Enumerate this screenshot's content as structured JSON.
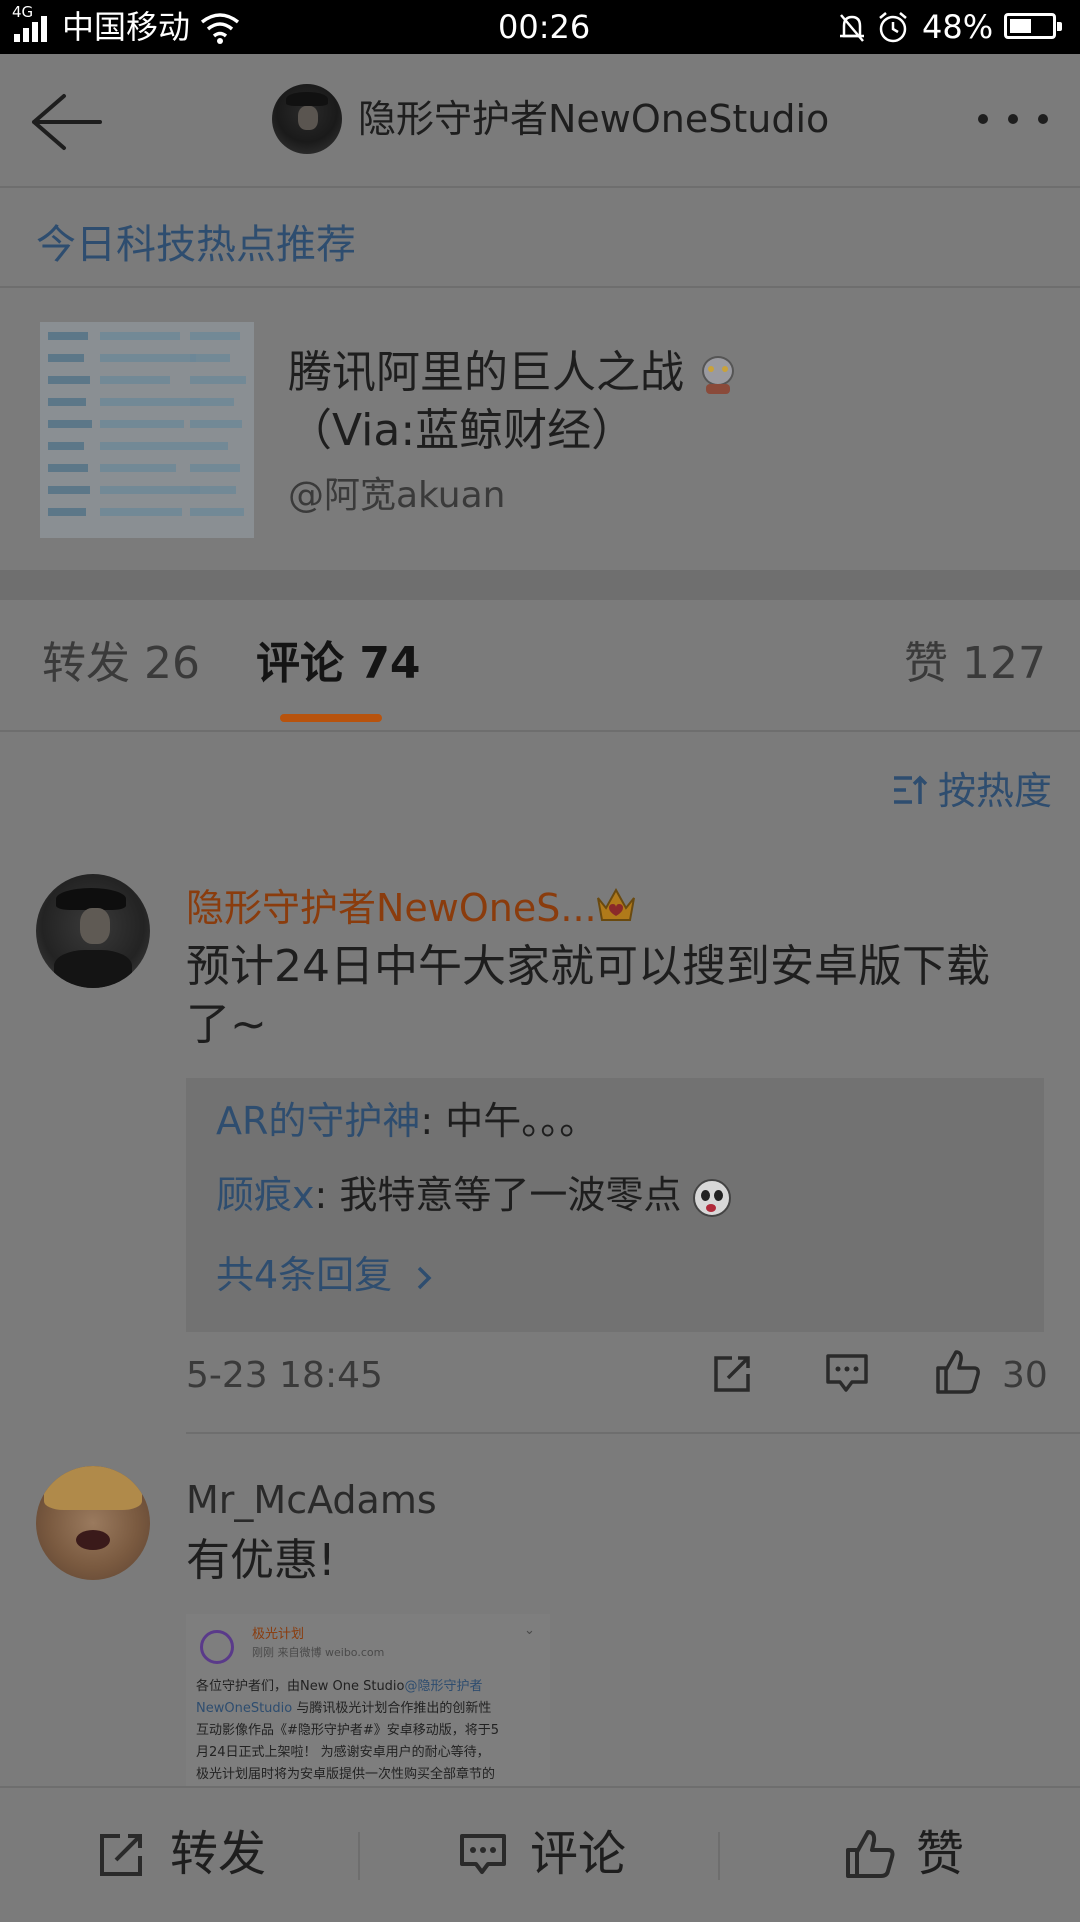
{
  "status_bar": {
    "network_type": "4G",
    "carrier": "中国移动",
    "time": "00:26",
    "battery_percent": "48%",
    "battery_level": 0.48
  },
  "header": {
    "title": "隐形守护者NewOneStudio"
  },
  "source": {
    "label": "今日科技热点推荐"
  },
  "card": {
    "title_line1": "腾讯阿里的巨人之战",
    "title_line2": "（Via:蓝鲸财经）",
    "author": "@阿宽akuan"
  },
  "tabs": {
    "repost": "转发 26",
    "comment": "评论 74",
    "like": "赞 127"
  },
  "sort": {
    "label": "按热度"
  },
  "comments": [
    {
      "username": "隐形守护者NewOneS...",
      "text_line1": "预计24日中午大家就可以搜到安卓版下载",
      "text_line2": "了~",
      "replies": [
        {
          "name": "AR的守护神",
          "text": ": 中午。。。"
        },
        {
          "name": "顾痕x",
          "text": ": 我特意等了一波零点"
        }
      ],
      "more_replies": "共4条回复",
      "timestamp": "5-23 18:45",
      "like_count": "30"
    },
    {
      "username": "Mr_McAdams",
      "text": "有优惠!",
      "embed": {
        "account": "极光计划",
        "meta": "刚刚  来自微博 weibo.com",
        "line1_a": "各位守护者们，由New One Studio",
        "line1_b": "@隐形守护者",
        "line2_a": "NewOneStudio",
        "line2_b": " 与腾讯极光计划合作推出的创新性",
        "line3": "互动影像作品《#隐形守护者#》安卓移动版，将于5",
        "line4": "月24日正式上架啦！ 为感谢安卓用户的耐心等待，",
        "line5": "极光计划届时将为安卓版提供一次性购买全部章节的"
      }
    }
  ],
  "bottom_bar": {
    "repost": "转发",
    "comment": "评论",
    "like": "赞"
  },
  "colors": {
    "link": "#2e4d6f",
    "username_vip": "#8a3c0d",
    "tab_indicator": "#b8530d"
  },
  "icons": [
    "back-arrow-icon",
    "more-icon",
    "signal-icon",
    "wifi-icon",
    "bell-icon",
    "alarm-icon",
    "battery-icon",
    "sort-icon",
    "crown-icon",
    "robot-emoji-icon",
    "panda-emoji-icon",
    "chevron-right-icon",
    "share-icon",
    "comment-icon",
    "like-icon"
  ]
}
